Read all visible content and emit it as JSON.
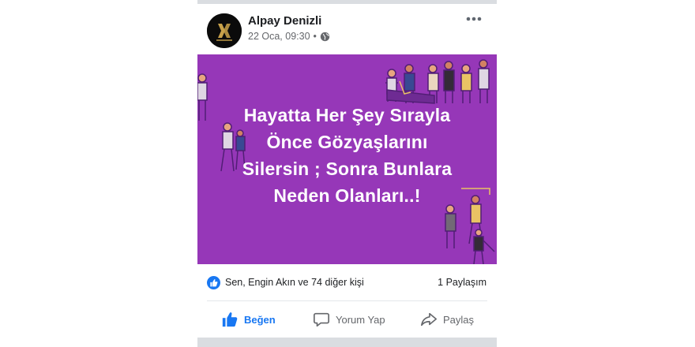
{
  "post": {
    "author": "Alpay Denizli",
    "date": "22 Oca, 09:30",
    "separator": "•",
    "avatar_logo_text": "DENİZLİ EVİ",
    "privacy_icon": "globe-icon",
    "more_icon": "more-dots-icon"
  },
  "banner": {
    "background": "#9637b8",
    "lines": [
      "Hayatta Her Şey Sırayla",
      "Önce Gözyaşlarını",
      "Silersin ; Sonra Bunlara",
      "Neden Olanları..!"
    ]
  },
  "stats": {
    "reactions_text": "Sen, Engin Akın ve 74 diğer kişi",
    "shares_text": "1 Paylaşım"
  },
  "actions": {
    "like_label": "Beğen",
    "comment_label": "Yorum Yap",
    "share_label": "Paylaş"
  },
  "colors": {
    "accent": "#1877f2",
    "secondary_text": "#65676b"
  }
}
